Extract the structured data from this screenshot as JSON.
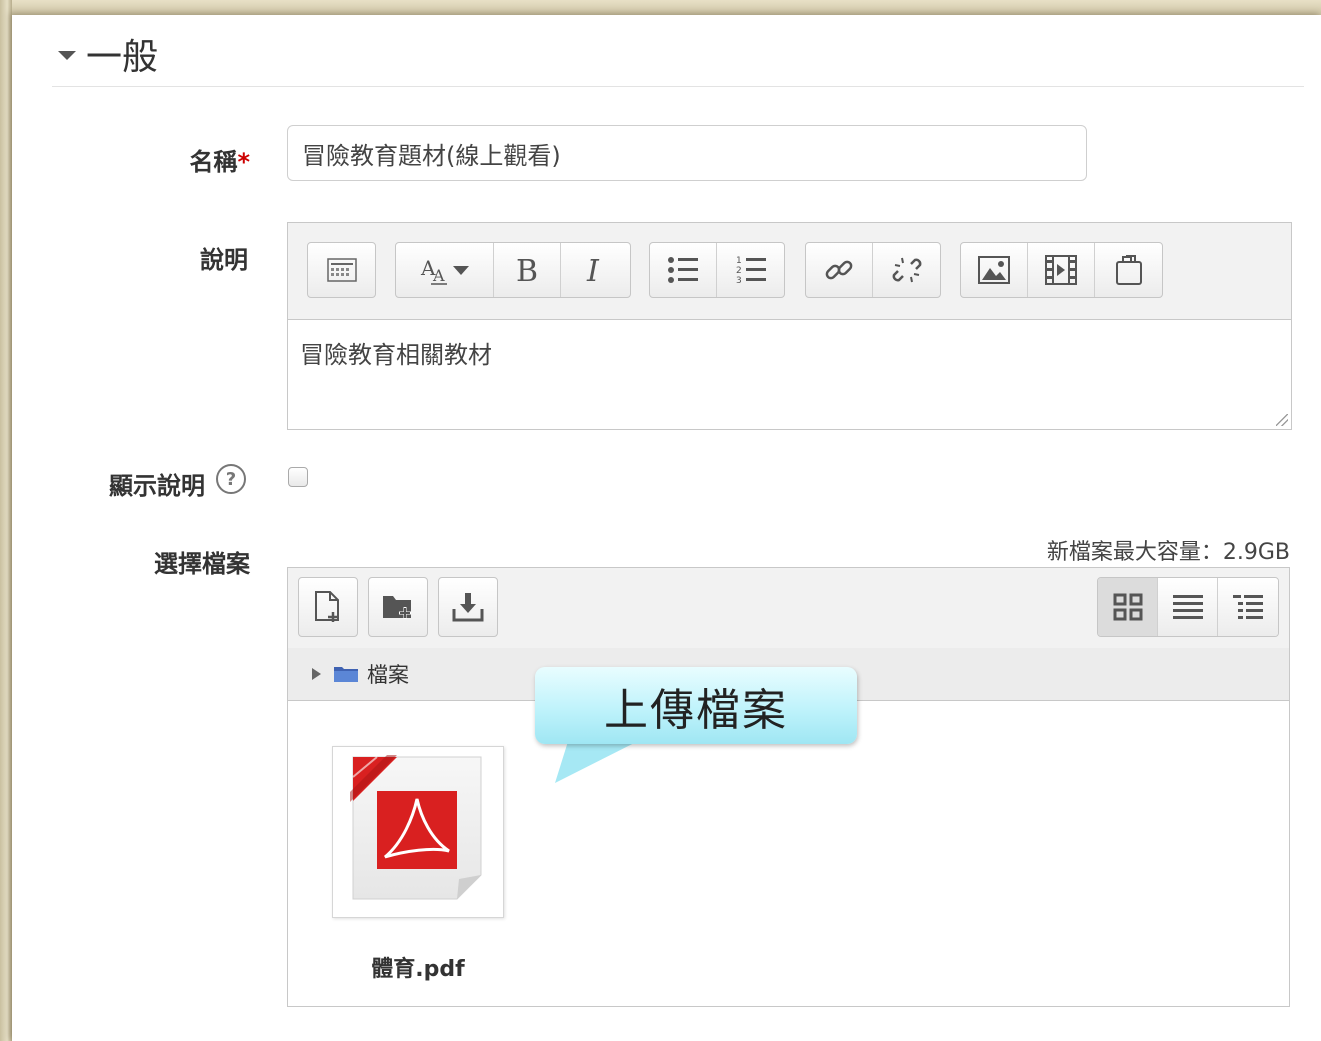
{
  "section": {
    "title": "一般"
  },
  "name_field": {
    "label": "名稱",
    "required_mark": "*",
    "value": "冒險教育題材(線上觀看)"
  },
  "description_field": {
    "label": "說明",
    "content": "冒險教育相關教材",
    "toolbar": [
      "toolbar-toggle-icon",
      "font-size-icon",
      "bold-icon",
      "italic-icon",
      "bullet-list-icon",
      "numbered-list-icon",
      "link-icon",
      "unlink-icon",
      "image-icon",
      "media-icon",
      "manage-files-icon"
    ]
  },
  "show_description": {
    "label": "顯示說明",
    "help_glyph": "?",
    "checked": false
  },
  "files_field": {
    "label": "選擇檔案",
    "max_size": "新檔案最大容量：2.9GB",
    "path_folder": "檔案",
    "files": [
      {
        "name": "體育.pdf",
        "type": "pdf"
      }
    ],
    "view_mode": "icons"
  },
  "callout": {
    "text": "上傳檔案"
  },
  "colors": {
    "required": "#cc0000",
    "callout_top": "#e9fdff",
    "callout_bottom": "#9fe6f3",
    "pdf_red": "#d92020"
  }
}
